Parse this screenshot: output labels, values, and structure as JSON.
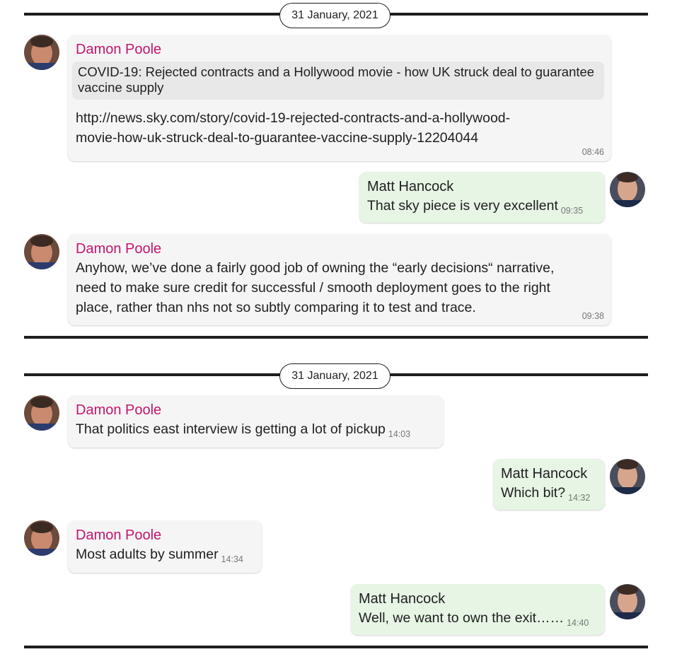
{
  "sections": [
    {
      "date": "31 January, 2021",
      "messages": [
        {
          "sender": "Damon Poole",
          "link_preview_title": "COVID-19: Rejected contracts and a Hollywood movie - how UK struck deal to guarantee vaccine supply",
          "text": "http://news.sky.com/story/covid-19-rejected-contracts-and-a-hollywood-movie-how-uk-struck-deal-to-guarantee-vaccine-supply-12204044",
          "line1": "http://news.sky.com/story/covid-19-rejected-contracts-and-a-hollywood-",
          "line2": "movie-how-uk-struck-deal-to-guarantee-vaccine-supply-12204044",
          "time": "08:46"
        },
        {
          "sender": "Matt Hancock",
          "text": "That sky piece is very excellent",
          "time": "09:35"
        },
        {
          "sender": "Damon Poole",
          "line1": "Anyhow, we’ve done a fairly good job of owning the “early decisions“ narrative,",
          "line2": "need to make sure credit for successful / smooth deployment goes to the right",
          "line3": "place, rather than nhs not so subtly comparing it to test and trace.",
          "time": "09:38"
        }
      ]
    },
    {
      "date": "31 January, 2021",
      "messages": [
        {
          "sender": "Damon Poole",
          "text": "That politics east interview is getting a lot of pickup",
          "time": "14:03"
        },
        {
          "sender": "Matt Hancock",
          "text": "Which bit?",
          "time": "14:32"
        },
        {
          "sender": "Damon Poole",
          "text": "Most adults by summer",
          "time": "14:34"
        },
        {
          "sender": "Matt Hancock",
          "text": "Well, we want to own the exit……",
          "time": "14:40"
        }
      ]
    }
  ],
  "colors": {
    "sender_damon": "#c2166f",
    "incoming_bubble": "#f5f5f5",
    "outgoing_bubble": "#e6f5e4",
    "rule": "#1e1e1e"
  },
  "icons": {
    "damon_avatar": "avatar-photo",
    "matt_avatar": "avatar-photo"
  }
}
